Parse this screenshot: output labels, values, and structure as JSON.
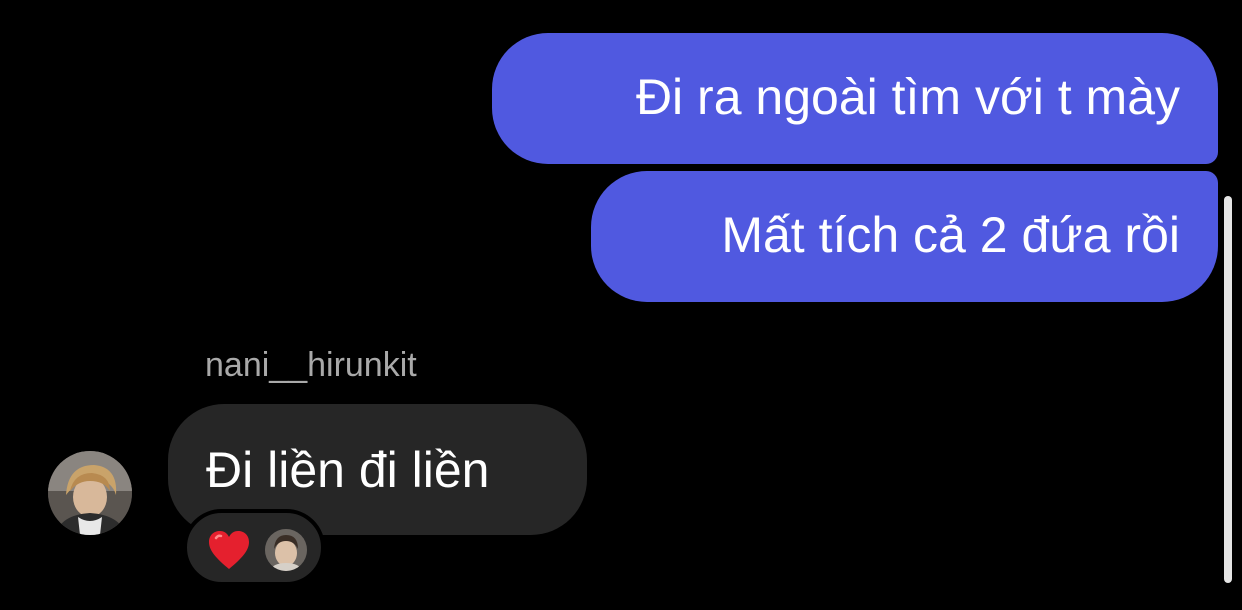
{
  "messages": {
    "outgoing": [
      {
        "text": "Đi ra ngoài tìm với t mày"
      },
      {
        "text": "Mất tích cả 2 đứa rồi"
      }
    ],
    "incoming": {
      "sender": "nani__hirunkit",
      "text": "Đi liền đi liền",
      "reactions": {
        "emoji": "❤️"
      }
    }
  },
  "colors": {
    "background": "#000000",
    "outgoing_bubble": "#5059e0",
    "incoming_bubble": "#262626",
    "sender_name": "#a9a9a9",
    "scrollbar": "#e5e5e5"
  },
  "icons": {
    "heart": "red-heart-icon",
    "avatar": "user-avatar-photo"
  }
}
